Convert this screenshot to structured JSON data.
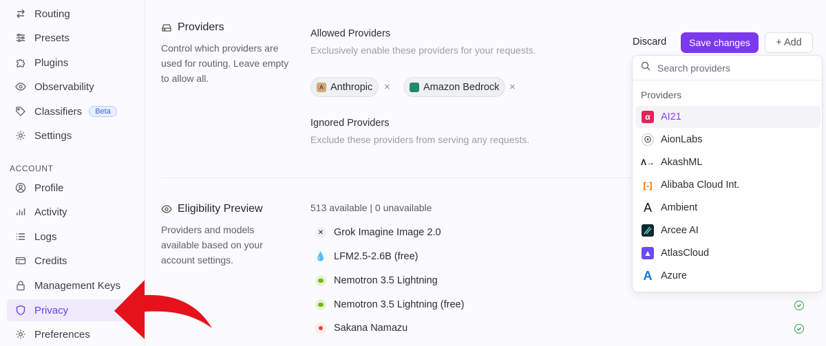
{
  "sidebar": {
    "items": [
      {
        "label": "Routing",
        "icon": "arrows-exchange-icon"
      },
      {
        "label": "Presets",
        "icon": "sliders-icon"
      },
      {
        "label": "Plugins",
        "icon": "puzzle-icon"
      },
      {
        "label": "Observability",
        "icon": "eye-icon"
      },
      {
        "label": "Classifiers",
        "icon": "tag-icon",
        "badge": "Beta"
      },
      {
        "label": "Settings",
        "icon": "gear-icon"
      }
    ],
    "account_label": "ACCOUNT",
    "account_items": [
      {
        "label": "Profile",
        "icon": "user-icon"
      },
      {
        "label": "Activity",
        "icon": "bar-chart-icon"
      },
      {
        "label": "Logs",
        "icon": "list-icon"
      },
      {
        "label": "Credits",
        "icon": "credit-card-icon"
      },
      {
        "label": "Management Keys",
        "icon": "lock-icon"
      },
      {
        "label": "Privacy",
        "icon": "shield-icon",
        "active": true
      },
      {
        "label": "Preferences",
        "icon": "gear-icon"
      }
    ]
  },
  "providers_section": {
    "title": "Providers",
    "description": "Control which providers are used for routing. Leave empty to allow all.",
    "allowed_label": "Allowed Providers",
    "allowed_help": "Exclusively enable these providers for your requests.",
    "allowed_chips": [
      {
        "label": "Anthropic"
      },
      {
        "label": "Amazon Bedrock"
      }
    ],
    "ignored_label": "Ignored Providers",
    "ignored_help": "Exclude these providers from serving any requests."
  },
  "header_actions": {
    "discard": "Discard",
    "save": "Save changes",
    "add": "+ Add"
  },
  "eligibility": {
    "title": "Eligibility Preview",
    "description": "Providers and models available based on your account settings.",
    "summary": "513 available | 0 unavailable",
    "models": [
      {
        "label": "Grok Imagine Image 2.0",
        "icon": "xai-icon"
      },
      {
        "label": "LFM2.5-2.6B (free)",
        "icon": "liquid-drop-icon"
      },
      {
        "label": "Nemotron 3.5 Lightning",
        "icon": "nvidia-icon"
      },
      {
        "label": "Nemotron 3.5 Lightning (free)",
        "icon": "nvidia-icon"
      },
      {
        "label": "Sakana Namazu",
        "icon": "sakana-icon"
      }
    ]
  },
  "dropdown": {
    "search_placeholder": "Search providers",
    "heading": "Providers",
    "items": [
      {
        "label": "AI21",
        "color": "#e6245a"
      },
      {
        "label": "AionLabs",
        "color": "#1f2328"
      },
      {
        "label": "AkashML",
        "color": "#111111"
      },
      {
        "label": "Alibaba Cloud Int.",
        "color": "#ff6a00"
      },
      {
        "label": "Ambient",
        "color": "#111111"
      },
      {
        "label": "Arcee AI",
        "color": "#0d2b2f"
      },
      {
        "label": "AtlasCloud",
        "color": "#6c4cf1"
      },
      {
        "label": "Azure",
        "color": "#0f78d4"
      }
    ]
  },
  "colors": {
    "accent": "#7c3aed",
    "active_bg": "#efebfd",
    "arrow": "#e6121b"
  }
}
